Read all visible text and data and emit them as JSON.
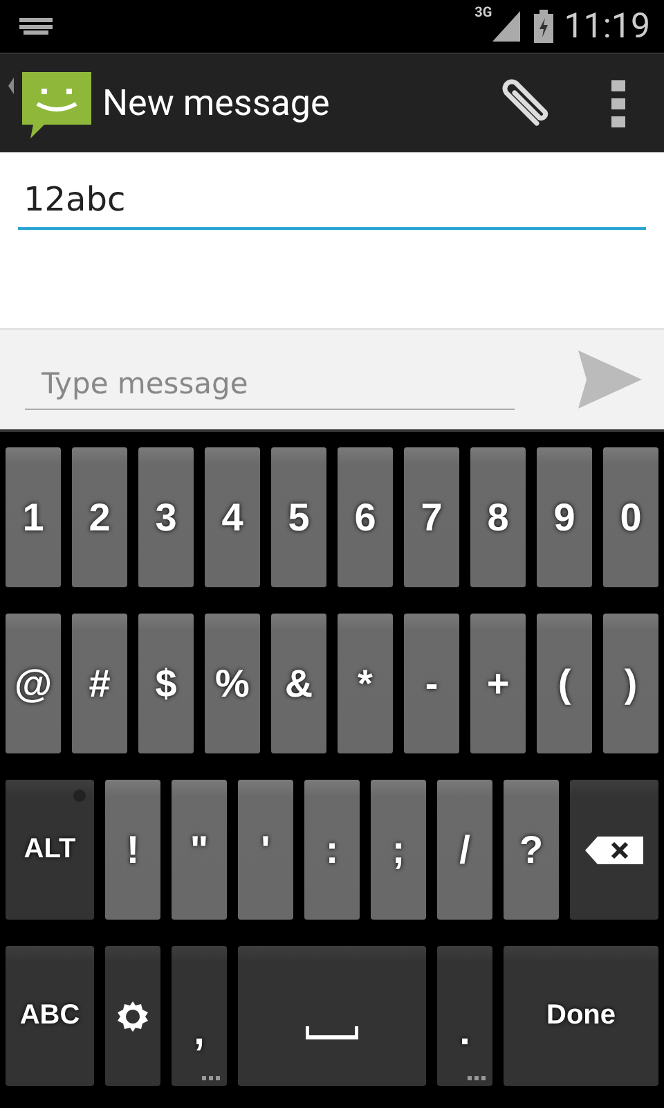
{
  "status_bar": {
    "network": "3G",
    "time": "11:19"
  },
  "action_bar": {
    "title": "New message"
  },
  "recipient": {
    "value": "12abc"
  },
  "compose": {
    "placeholder": "Type message"
  },
  "keyboard": {
    "rows": [
      {
        "keys": [
          {
            "label": "1",
            "kind": "symbol"
          },
          {
            "label": "2",
            "kind": "symbol"
          },
          {
            "label": "3",
            "kind": "symbol"
          },
          {
            "label": "4",
            "kind": "symbol"
          },
          {
            "label": "5",
            "kind": "symbol"
          },
          {
            "label": "6",
            "kind": "symbol"
          },
          {
            "label": "7",
            "kind": "symbol"
          },
          {
            "label": "8",
            "kind": "symbol"
          },
          {
            "label": "9",
            "kind": "symbol"
          },
          {
            "label": "0",
            "kind": "symbol"
          }
        ]
      },
      {
        "keys": [
          {
            "label": "@",
            "kind": "symbol"
          },
          {
            "label": "#",
            "kind": "symbol"
          },
          {
            "label": "$",
            "kind": "symbol"
          },
          {
            "label": "%",
            "kind": "symbol"
          },
          {
            "label": "&",
            "kind": "symbol"
          },
          {
            "label": "*",
            "kind": "symbol"
          },
          {
            "label": "-",
            "kind": "symbol"
          },
          {
            "label": "+",
            "kind": "symbol"
          },
          {
            "label": "(",
            "kind": "symbol"
          },
          {
            "label": ")",
            "kind": "symbol"
          }
        ]
      },
      {
        "keys": [
          {
            "label": "ALT",
            "kind": "alt"
          },
          {
            "label": "!",
            "kind": "symbol"
          },
          {
            "label": "\"",
            "kind": "symbol"
          },
          {
            "label": "'",
            "kind": "symbol"
          },
          {
            "label": ":",
            "kind": "symbol"
          },
          {
            "label": ";",
            "kind": "symbol"
          },
          {
            "label": "/",
            "kind": "symbol"
          },
          {
            "label": "?",
            "kind": "symbol"
          },
          {
            "kind": "backspace"
          }
        ]
      },
      {
        "keys": [
          {
            "label": "ABC",
            "kind": "mode"
          },
          {
            "kind": "settings"
          },
          {
            "label": ",",
            "kind": "punct"
          },
          {
            "kind": "space"
          },
          {
            "label": ".",
            "kind": "punct"
          },
          {
            "label": "Done",
            "kind": "action"
          }
        ]
      }
    ]
  }
}
